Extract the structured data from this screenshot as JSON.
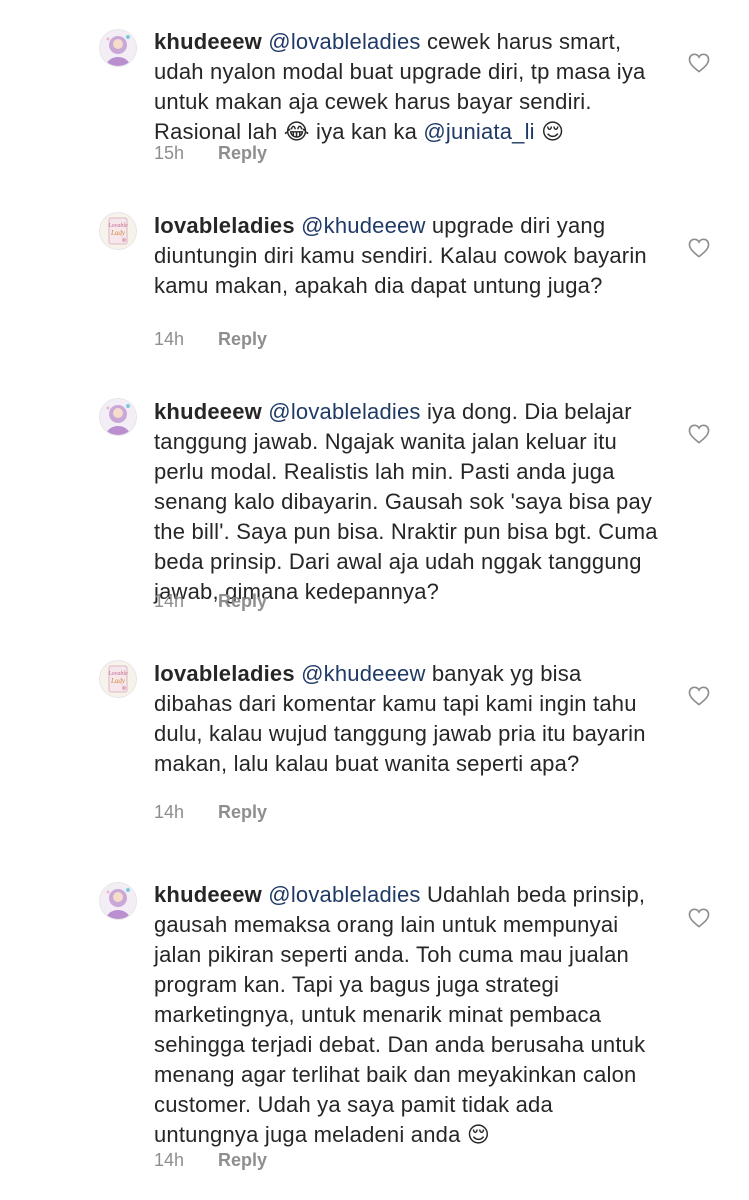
{
  "comments": [
    {
      "username": "khudeeew",
      "mention": "@lovableladies",
      "text": "cewek harus smart, udah nyalon modal buat upgrade diri, tp masa iya untuk makan aja cewek harus bayar sendiri. Rasional lah",
      "emoji1": "😂",
      "text2": "iya kan ka",
      "mention2": "@juniata_li",
      "emoji2": "😌",
      "time": "15h",
      "reply": "Reply",
      "avatar": "hijab-woman-avatar"
    },
    {
      "username": "lovableladies",
      "mention": "@khudeeew",
      "text": "upgrade diri yang diuntungin diri kamu sendiri. Kalau cowok bayarin kamu makan, apakah dia dapat untung juga?",
      "time": "14h",
      "reply": "Reply",
      "avatar": "lovable-lady-book-avatar"
    },
    {
      "username": "khudeeew",
      "mention": "@lovableladies",
      "text": "iya dong. Dia belajar tanggung jawab. Ngajak wanita jalan keluar itu perlu modal. Realistis lah min. Pasti anda juga senang kalo dibayarin. Gausah sok 'saya bisa pay the bill'. Saya pun bisa. Nraktir pun bisa bgt. Cuma beda prinsip. Dari awal aja udah nggak tanggung jawab, gimana kedepannya?",
      "time": "14h",
      "reply": "Reply",
      "avatar": "hijab-woman-avatar"
    },
    {
      "username": "lovableladies",
      "mention": "@khudeeew",
      "text": "banyak yg bisa dibahas dari komentar kamu tapi kami ingin tahu dulu, kalau wujud tanggung jawab pria itu bayarin makan, lalu kalau buat wanita seperti apa?",
      "time": "14h",
      "reply": "Reply",
      "avatar": "lovable-lady-book-avatar"
    },
    {
      "username": "khudeeew",
      "mention": "@lovableladies",
      "text": "Udahlah beda prinsip, gausah memaksa orang lain untuk mempunyai jalan pikiran seperti anda. Toh cuma mau jualan program kan. Tapi ya bagus juga strategi marketingnya, untuk menarik minat pembaca sehingga terjadi debat. Dan anda berusaha untuk menang agar terlihat baik dan meyakinkan calon customer. Udah ya saya pamit tidak ada untungnya juga meladeni anda",
      "emoji1": "😌",
      "time": "14h",
      "reply": "Reply",
      "avatar": "hijab-woman-avatar"
    }
  ],
  "colors": {
    "text": "#262626",
    "mention": "#1f3a66",
    "meta": "#8e8e8e"
  }
}
